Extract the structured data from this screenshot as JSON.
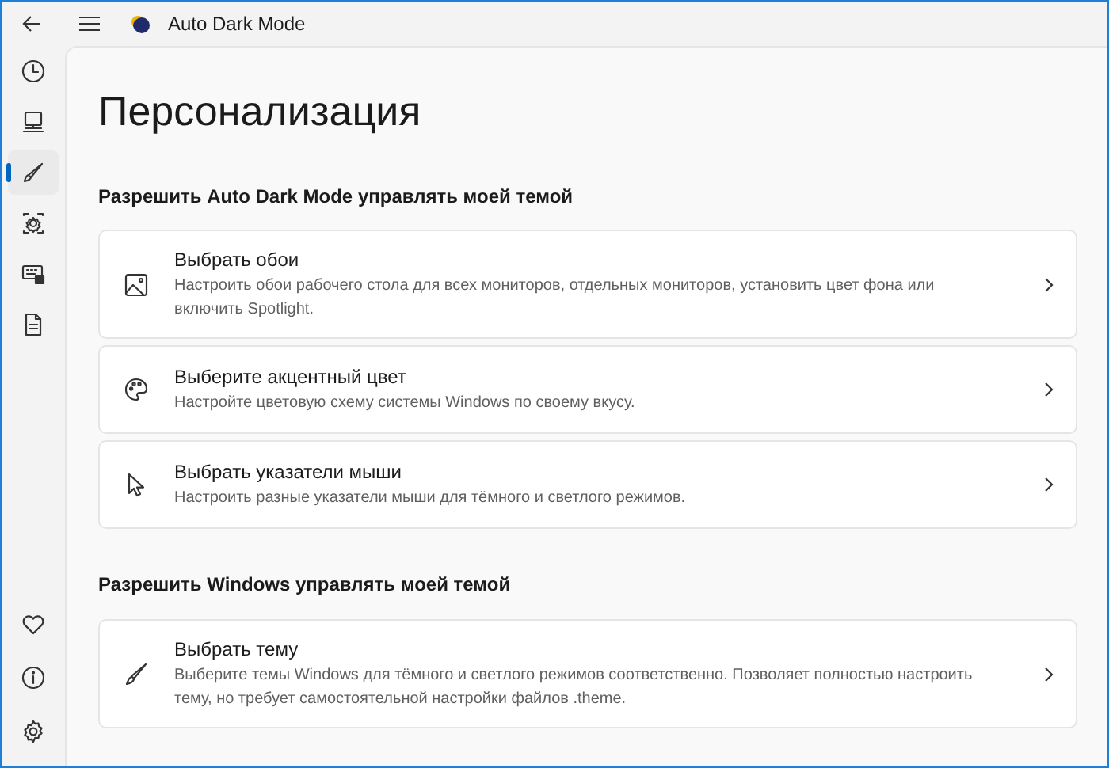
{
  "window": {
    "title": "Auto Dark Mode"
  },
  "nav": {
    "top_items": [
      {
        "selected": false
      },
      {
        "selected": false
      },
      {
        "selected": true
      },
      {
        "selected": false
      },
      {
        "selected": false
      },
      {
        "selected": false
      }
    ],
    "bottom_items": [
      {
        "selected": false
      },
      {
        "selected": false
      },
      {
        "selected": false
      }
    ]
  },
  "page_title": "Персонализация",
  "sections": [
    {
      "heading": "Разрешить Auto Dark Mode управлять моей темой",
      "cards": [
        {
          "title": "Выбрать обои",
          "description": "Настроить обои рабочего стола для всех мониторов, отдельных мониторов, установить цвет фона или включить Spotlight."
        },
        {
          "title": "Выберите акцентный цвет",
          "description": "Настройте цветовую схему системы Windows по своему вкусу."
        },
        {
          "title": "Выбрать указатели мыши",
          "description": "Настроить разные указатели мыши для тёмного и светлого режимов."
        }
      ]
    },
    {
      "heading": "Разрешить Windows управлять моей темой",
      "cards": [
        {
          "title": "Выбрать тему",
          "description": "Выберите темы Windows для тёмного и светлого режимов соответственно. Позволяет полностью настроить тему, но требует самостоятельной настройки файлов .theme."
        }
      ]
    }
  ]
}
